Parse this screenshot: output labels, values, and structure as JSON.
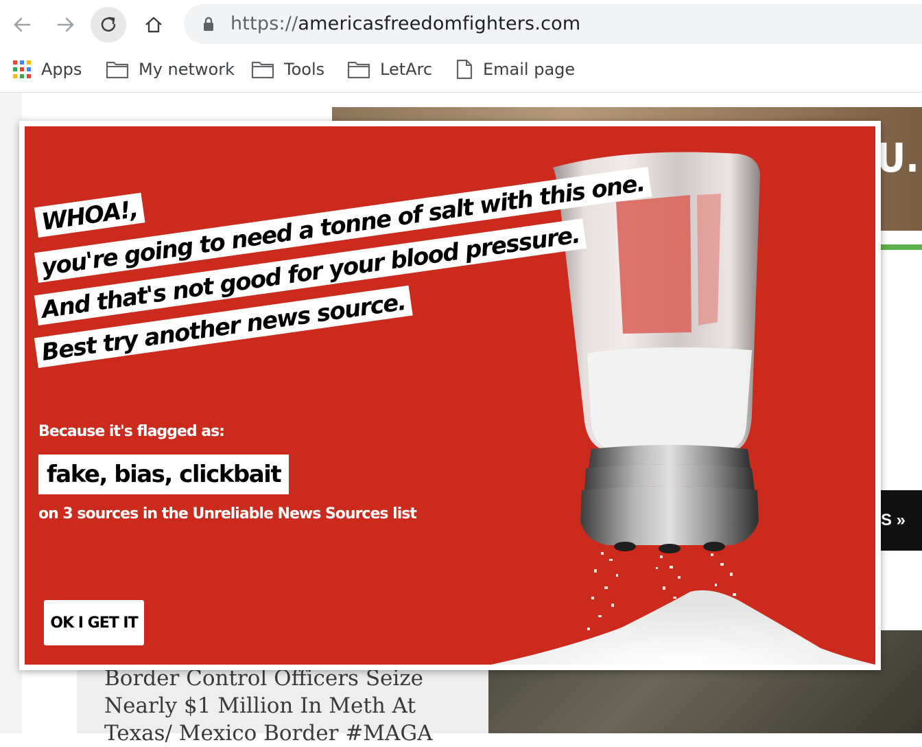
{
  "browser": {
    "url_scheme": "https://",
    "url_host": "americasfreedomfighters.com",
    "bookmarks": [
      {
        "label": "Apps",
        "icon": "apps-grid-icon"
      },
      {
        "label": "My network",
        "icon": "folder-icon"
      },
      {
        "label": "Tools",
        "icon": "folder-icon"
      },
      {
        "label": "LetArc",
        "icon": "folder-icon"
      },
      {
        "label": "Email page",
        "icon": "page-icon"
      }
    ]
  },
  "page": {
    "hero_text": "U.",
    "side_button_text": "S »",
    "article_title": "Border Control Officers Seize Nearly $1 Million In Meth At Texas/ Mexico Border #MAGA"
  },
  "modal": {
    "headline": [
      "WHOA!,",
      "you're going to need a tonne of salt with this one.",
      "And that's not good for your blood pressure.",
      "Best try another news source."
    ],
    "flag_label": "Because it's flagged as:",
    "flags": "fake, bias, clickbait",
    "sources": "on 3 sources in the Unreliable News Sources list",
    "ok_button": "OK I GET IT"
  },
  "colors": {
    "modal_red": "#cd2a1e",
    "green_accent": "#5cb14a"
  }
}
